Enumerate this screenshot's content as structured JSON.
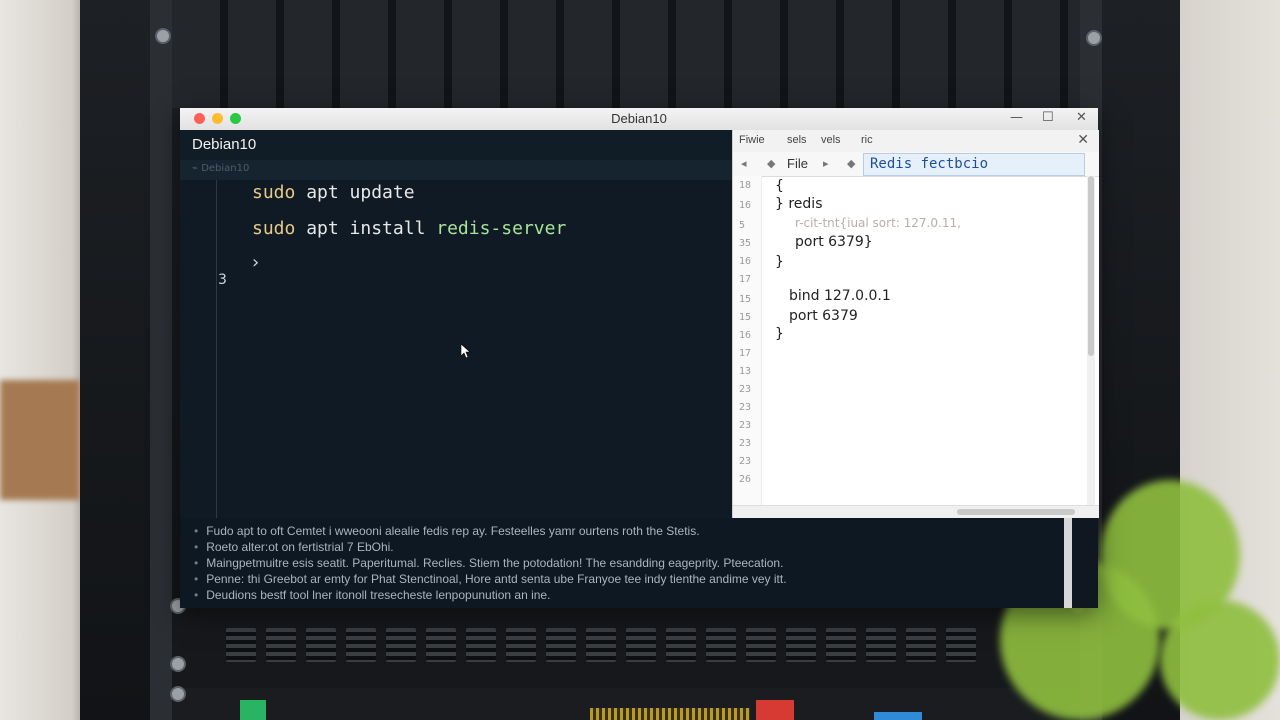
{
  "window": {
    "title": "Debian10",
    "controls": {
      "minimize": "—",
      "maximize": "☐",
      "close": "✕"
    }
  },
  "terminal": {
    "title": "Debian10",
    "subheader": "⌁ Debian10",
    "lines": [
      {
        "cmd": "sudo",
        "rest": " apt update",
        "pkg": ""
      },
      {
        "cmd": "sudo",
        "rest": " apt install ",
        "pkg": "redis-server"
      }
    ],
    "prompt": "›",
    "line_number": "3"
  },
  "editor": {
    "menu": [
      "Fiwie",
      "sels",
      "vels",
      "ric"
    ],
    "toolbar_file": "File",
    "tab_label": "Redis fectbcio",
    "line_numbers": [
      "18",
      "16",
      "5",
      "35",
      "16",
      "17",
      "15",
      "15",
      "16",
      "17",
      "13",
      "23",
      "23",
      "23",
      "23",
      "23",
      "26"
    ],
    "code": [
      {
        "text": "{",
        "indent": 0
      },
      {
        "text": "} redis",
        "indent": 0
      },
      {
        "text": "r-cit-tnt{iual sort: 127.0.11,",
        "indent": 2,
        "faded": true
      },
      {
        "text": "port 6379}",
        "indent": 2
      },
      {
        "text": "}",
        "indent": 0
      },
      {
        "text": "",
        "indent": 0
      },
      {
        "text": "bind 127.0.0.1",
        "indent": 1
      },
      {
        "text": "port 6379",
        "indent": 1
      },
      {
        "text": "}",
        "indent": 0
      }
    ]
  },
  "log": [
    "Fudo apt to oft Cemtet i wweooni alealie fedis rep ay. Festeelles yamr ourtens roth the Stetis.",
    "Roeto alter:ot on fertistrial 7 EbOhi.",
    "Maingpetmuitre esis seatit. Paperitumal. Reclies. Stiem the potodation! The esandding eageprity. Pteecation.",
    "Penne: thi Greebot ar emty for Phat Stenctinoal, Hore antd senta ube Franyoe tee indy tienthe andime vey itt.",
    "Deudions bestf tool lner itonoll tresecheste lenpopunution an ine."
  ],
  "colors": {
    "terminal_bg": "#0f1a24",
    "sudo": "#e7c98a",
    "package": "#a8e39a",
    "tab_accent": "#1b4f9c"
  }
}
